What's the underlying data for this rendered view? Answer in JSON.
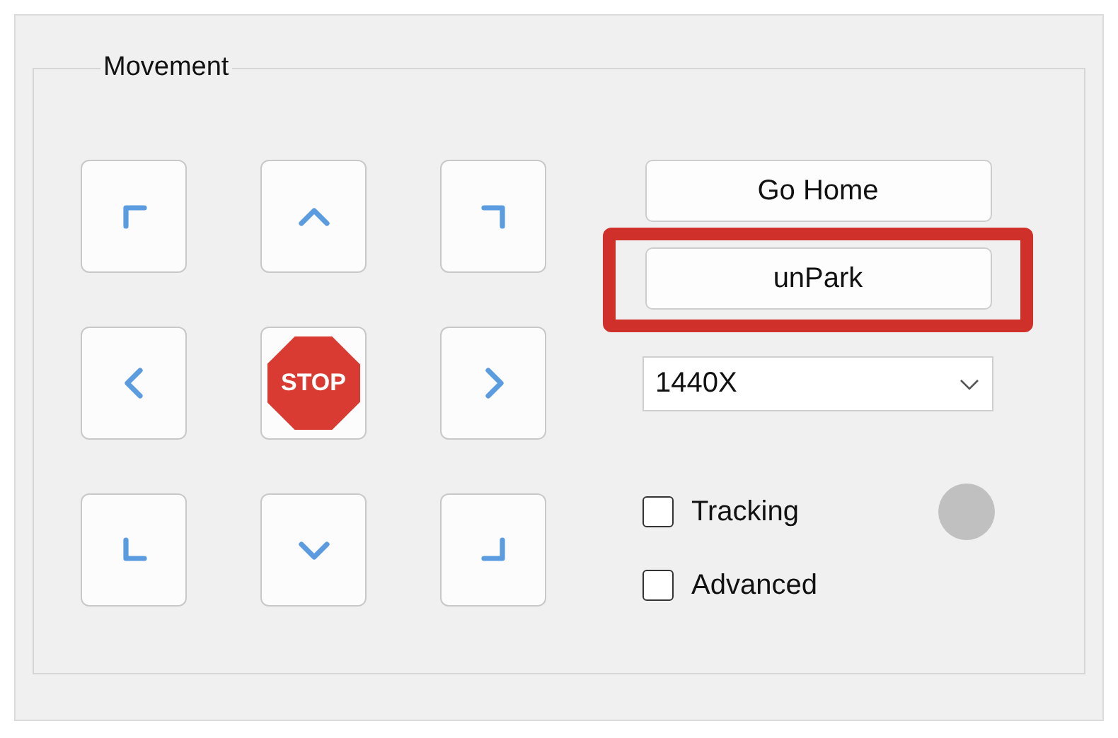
{
  "group": {
    "title": "Movement"
  },
  "pad": [
    {
      "kind": "up_left"
    },
    {
      "kind": "up"
    },
    {
      "kind": "up_right"
    },
    {
      "kind": "left"
    },
    {
      "kind": "stop",
      "label": "STOP"
    },
    {
      "kind": "right"
    },
    {
      "kind": "down_left"
    },
    {
      "kind": "down"
    },
    {
      "kind": "down_right"
    }
  ],
  "go_home": {
    "label": "Go Home"
  },
  "unpark": {
    "label": "unPark",
    "highlighted": true
  },
  "rate_dropdown": {
    "value": "1440X"
  },
  "options": [
    {
      "label": "Tracking",
      "checked": false
    },
    {
      "label": "Advanced",
      "checked": false
    }
  ],
  "status_indicator": {
    "on": false
  }
}
